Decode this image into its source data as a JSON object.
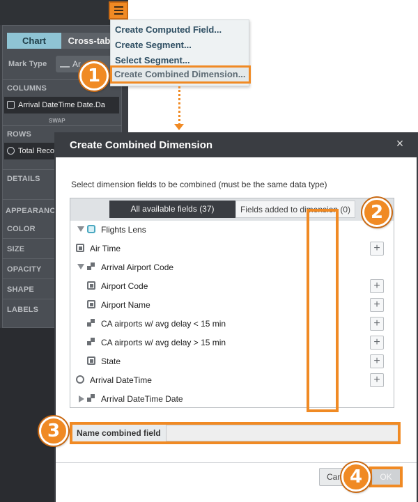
{
  "left_panel": {
    "tabs": [
      "Chart",
      "Cross-tab"
    ],
    "mark_type_label": "Mark Type",
    "mark_type_value": "Ar",
    "columns_label": "COLUMNS",
    "column_field": "Arrival DateTime Date.Da",
    "swap_label": "SWAP",
    "rows_label": "ROWS",
    "row_field": "Total Reco",
    "details_label": "DETAILS",
    "appearance_label": "APPEARANCE",
    "color_label": "COLOR",
    "size_label": "SIZE",
    "opacity_label": "OPACITY",
    "shape_label": "SHAPE",
    "labels_label": "LABELS"
  },
  "menu": {
    "items": [
      "Create Computed Field...",
      "Create Segment...",
      "Select Segment...",
      "Create Combined Dimension..."
    ]
  },
  "dialog": {
    "title": "Create Combined Dimension",
    "close": "×",
    "instruction": "Select dimension fields to be combined (must be the same data type)",
    "tabs": [
      "All available fields (37)",
      "Fields added to dimension (0)"
    ],
    "fields": [
      {
        "label": "Flights Lens",
        "expander": "down",
        "icon": "lens",
        "plus": false
      },
      {
        "label": "Air Time",
        "expander": "",
        "icon": "stack",
        "plus": true
      },
      {
        "label": "Arrival Airport Code",
        "expander": "down",
        "icon": "combo",
        "plus": false
      },
      {
        "label": "Airport Code",
        "expander": "",
        "icon": "stack",
        "plus": true
      },
      {
        "label": "Airport Name",
        "expander": "",
        "icon": "stack",
        "plus": true
      },
      {
        "label": "CA airports w/ avg delay < 15 min",
        "expander": "",
        "icon": "combo",
        "plus": true
      },
      {
        "label": "CA airports w/ avg delay > 15 min",
        "expander": "",
        "icon": "combo",
        "plus": true
      },
      {
        "label": "State",
        "expander": "",
        "icon": "stack",
        "plus": true
      },
      {
        "label": "Arrival DateTime",
        "expander": "",
        "icon": "clock",
        "plus": true
      },
      {
        "label": "Arrival DateTime Date",
        "expander": "right",
        "icon": "combo",
        "plus": false
      }
    ],
    "plus_symbol": "+",
    "name_label": "Name combined field",
    "name_value": "",
    "cancel_label": "Cancel",
    "ok_label": "OK"
  },
  "callouts": [
    "1",
    "2",
    "3",
    "4"
  ],
  "colors": {
    "accent": "#f08a24",
    "dialog_header": "#3a3d42",
    "active_tab": "#8fc4d4"
  }
}
